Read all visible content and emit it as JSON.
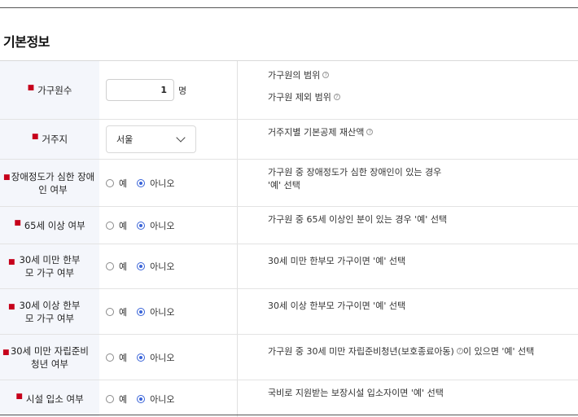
{
  "section_title": "기본정보",
  "radio_yes": "예",
  "radio_no": "아니오",
  "rows": [
    {
      "label": "가구원수",
      "input": {
        "value": "1",
        "unit": "명"
      },
      "desc": [
        "가구원의 범위",
        "가구원 제외 범위"
      ]
    },
    {
      "label": "거주지",
      "input": {
        "selected": "서울"
      },
      "desc": [
        "거주지별 기본공제 재산액"
      ]
    },
    {
      "label": "장애정도가 심한 장애인 여부",
      "selected": "아니오",
      "desc": [
        "가구원 중 장애정도가 심한 장애인이 있는 경우",
        "'예' 선택"
      ]
    },
    {
      "label": "65세 이상 여부",
      "selected": "아니오",
      "desc": [
        "가구원 중 65세 이상인 분이 있는 경우 '예' 선택"
      ]
    },
    {
      "label": "30세 미만 한부모 가구 여부",
      "selected": "아니오",
      "desc": [
        "30세 미만 한부모 가구이면 '예' 선택"
      ]
    },
    {
      "label": "30세 이상 한부모 가구 여부",
      "selected": "아니오",
      "desc": [
        "30세 이상 한부모 가구이면 '예' 선택"
      ]
    },
    {
      "label": "30세 미만 자립준비 청년 여부",
      "selected": "아니오",
      "desc": [
        "가구원 중 30세 미만 자립준비청년(보호종료아동)",
        "이 있으면 '예' 선택"
      ]
    },
    {
      "label": "시설 입소 여부",
      "selected": "아니오",
      "desc": [
        "국비로 지원받는 보장시설 입소자이면 '예' 선택"
      ]
    }
  ],
  "required_mark": "■",
  "help_icon": "?"
}
